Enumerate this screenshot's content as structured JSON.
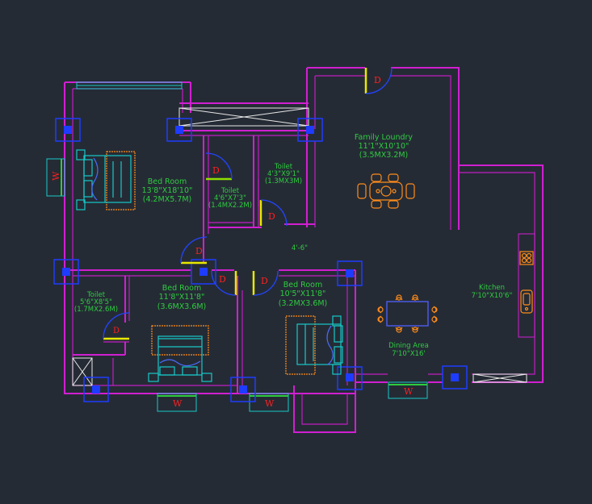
{
  "rooms": {
    "bed1": {
      "name": "Bed Room",
      "size_ft": "13'8\"X18'10\"",
      "size_m": "(4.2MX5.7M)"
    },
    "toilet_a": {
      "name": "Toilet",
      "size_ft": "4'6\"X7'3\"",
      "size_m": "(1.4MX2.2M)"
    },
    "toilet_b": {
      "name": "Toilet",
      "size_ft": "4'3\"X9'1\"",
      "size_m": "(1.3MX3M)"
    },
    "family": {
      "name": "Family Loundry",
      "size_ft": "11'1\"X10'10\"",
      "size_m": "(3.5MX3.2M)"
    },
    "toilet_c": {
      "name": "Toilet",
      "size_ft": "5'6\"X8'5\"",
      "size_m": "(1.7MX2.6M)"
    },
    "bed2": {
      "name": "Bed Room",
      "size_ft": "11'8\"X11'8\"",
      "size_m": "(3.6MX3.6M)"
    },
    "bed3": {
      "name": "Bed Room",
      "size_ft": "10'5\"X11'8\"",
      "size_m": "(3.2MX3.6M)"
    },
    "kitchen": {
      "name": "Kitchen",
      "size_ft": "7'10\"X10'6\""
    },
    "dining": {
      "name": "Dining Area",
      "size_ft": "7'10\"X16'"
    }
  },
  "dims": {
    "passage": "4'-6\""
  },
  "marks": {
    "door": "D",
    "window": "W"
  },
  "colors": {
    "background": "#252b35",
    "wall": "#d11fd1",
    "column": "#1e3cff",
    "label": "#2ecc40",
    "door_mark": "#ff2020",
    "furniture_bed": "#18c8c8",
    "furniture_frame": "#ff8c1a"
  }
}
